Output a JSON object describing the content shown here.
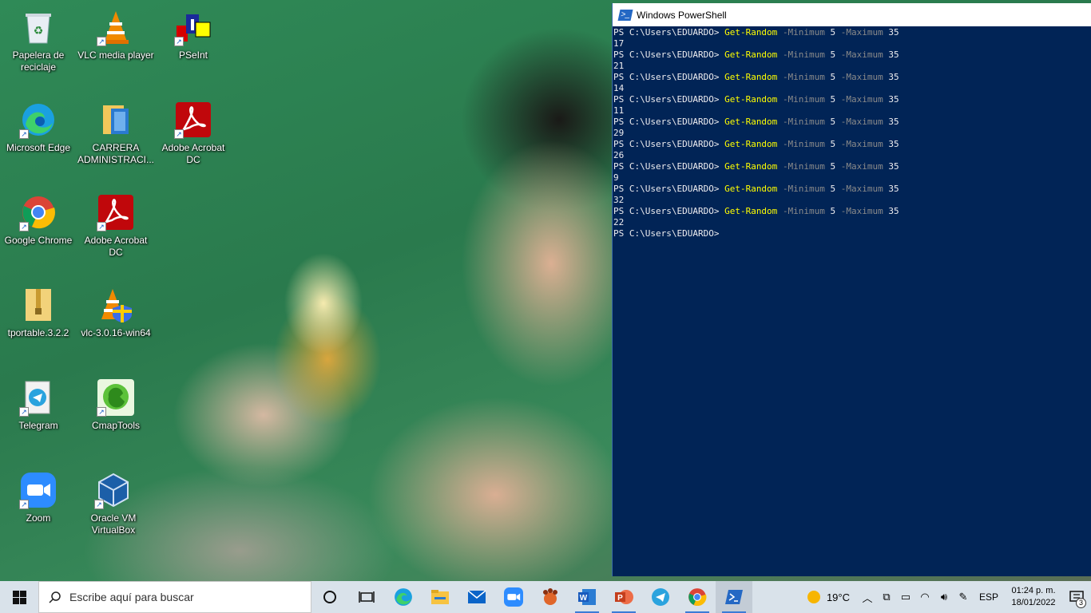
{
  "desktop": {
    "icons": [
      {
        "label": "Papelera de reciclaje",
        "icon": "recycle-bin-icon"
      },
      {
        "label": "VLC media player",
        "icon": "vlc-icon"
      },
      {
        "label": "PSeInt",
        "icon": "pseint-icon"
      },
      {
        "label": "Microsoft Edge",
        "icon": "edge-icon"
      },
      {
        "label": "CARRERA ADMINISTRACI...",
        "icon": "folder-icon"
      },
      {
        "label": "Adobe Acrobat DC",
        "icon": "acrobat-icon"
      },
      {
        "label": "Google Chrome",
        "icon": "chrome-icon"
      },
      {
        "label": "Adobe Acrobat DC",
        "icon": "acrobat-icon"
      },
      {
        "label": "tportable.3.2.2",
        "icon": "zip-folder-icon"
      },
      {
        "label": "vlc-3.0.16-win64",
        "icon": "vlc-installer-icon"
      },
      {
        "label": "Telegram",
        "icon": "telegram-icon"
      },
      {
        "label": "CmapTools",
        "icon": "cmaptools-icon"
      },
      {
        "label": "Zoom",
        "icon": "zoom-icon"
      },
      {
        "label": "Oracle VM VirtualBox",
        "icon": "virtualbox-icon"
      }
    ]
  },
  "powershell": {
    "title": "Windows PowerShell",
    "prompt": "PS C:\\Users\\EDUARDO>",
    "command": "Get-Random",
    "min_flag": "-Minimum",
    "min_value": "5",
    "max_flag": "-Maximum",
    "max_value": "35",
    "outputs": [
      "17",
      "21",
      "14",
      "11",
      "29",
      "26",
      "9",
      "32",
      "22"
    ]
  },
  "taskbar": {
    "search_placeholder": "Escribe aquí para buscar",
    "weather": "19°C",
    "language": "ESP",
    "time": "01:24 p. m.",
    "date": "18/01/2022",
    "notification_count": "3",
    "accent": "#3c7bd6"
  }
}
